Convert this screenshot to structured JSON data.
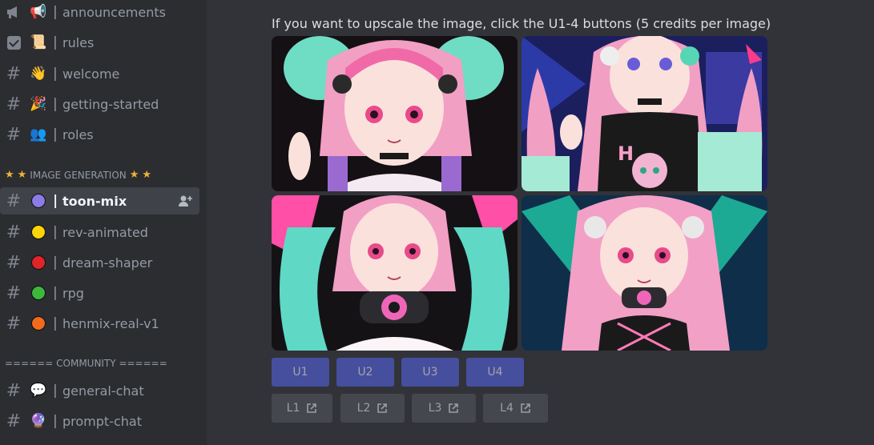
{
  "sidebar": {
    "channels": [
      {
        "lead": "megaphone-icon",
        "emoji": "📢",
        "name": "announcements"
      },
      {
        "lead": "checkbox-icon",
        "emoji": "📜",
        "name": "rules"
      },
      {
        "lead": "hash-icon",
        "emoji": "👋",
        "name": "welcome"
      },
      {
        "lead": "hash-icon",
        "emoji": "🎉",
        "name": "getting-started"
      },
      {
        "lead": "hash-icon",
        "emoji": "👥",
        "name": "roles"
      }
    ],
    "category_image": "IMAGE GENERATION",
    "gen_channels": [
      {
        "color": "#8c7ae6",
        "name": "toon-mix",
        "active": true
      },
      {
        "color": "#fbd40a",
        "name": "rev-animated"
      },
      {
        "color": "#e0242a",
        "name": "dream-shaper"
      },
      {
        "color": "#3cb83c",
        "name": "rpg"
      },
      {
        "color": "#f26a1b",
        "name": "henmix-real-v1"
      }
    ],
    "category_community": "====== COMMUNITY ======",
    "community_channels": [
      {
        "emoji": "💬",
        "name": "general-chat"
      },
      {
        "emoji": "🔮",
        "name": "prompt-chat"
      }
    ],
    "separator": "|"
  },
  "message": {
    "caption": "If you want to upscale the image, click the U1-4 buttons  (5 credits per image)",
    "upscale_buttons": [
      "U1",
      "U2",
      "U3",
      "U4"
    ],
    "link_buttons": [
      "L1",
      "L2",
      "L3",
      "L4"
    ]
  },
  "colors": {
    "blurple": "#5865f2",
    "sidebar_bg": "#2b2d31",
    "main_bg": "#313338"
  }
}
